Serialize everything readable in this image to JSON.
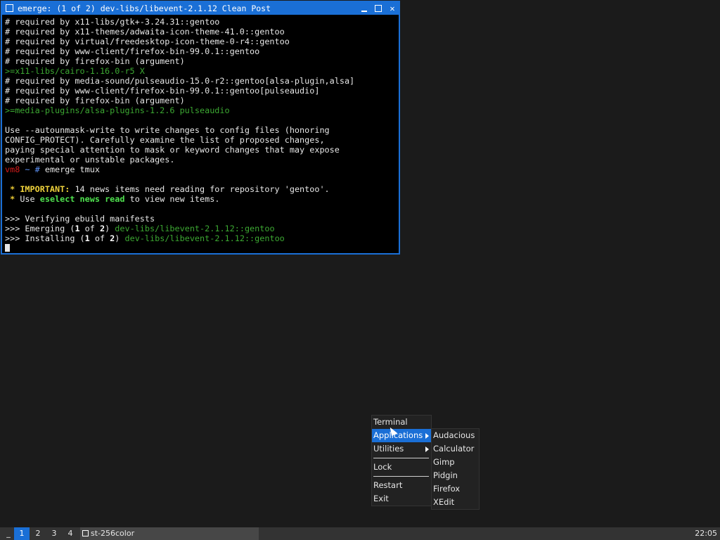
{
  "window": {
    "title": "emerge: (1 of 2) dev-libs/libevent-2.1.12 Clean Post"
  },
  "terminal_lines": [
    [
      {
        "t": "# required by x11-libs/gtk+-3.24.31::gentoo",
        "c": ""
      }
    ],
    [
      {
        "t": "# required by x11-themes/adwaita-icon-theme-41.0::gentoo",
        "c": ""
      }
    ],
    [
      {
        "t": "# required by virtual/freedesktop-icon-theme-0-r4::gentoo",
        "c": ""
      }
    ],
    [
      {
        "t": "# required by www-client/firefox-bin-99.0.1::gentoo",
        "c": ""
      }
    ],
    [
      {
        "t": "# required by firefox-bin (argument)",
        "c": ""
      }
    ],
    [
      {
        "t": ">=x11-libs/cairo-1.16.0-r5 X",
        "c": "green"
      }
    ],
    [
      {
        "t": "# required by media-sound/pulseaudio-15.0-r2::gentoo[alsa-plugin,alsa]",
        "c": ""
      }
    ],
    [
      {
        "t": "# required by www-client/firefox-bin-99.0.1::gentoo[pulseaudio]",
        "c": ""
      }
    ],
    [
      {
        "t": "# required by firefox-bin (argument)",
        "c": ""
      }
    ],
    [
      {
        "t": ">=media-plugins/alsa-plugins-1.2.6 pulseaudio",
        "c": "green"
      }
    ],
    [
      {
        "t": "",
        "c": ""
      }
    ],
    [
      {
        "t": "Use --autounmask-write to write changes to config files (honoring",
        "c": ""
      }
    ],
    [
      {
        "t": "CONFIG_PROTECT). Carefully examine the list of proposed changes,",
        "c": ""
      }
    ],
    [
      {
        "t": "paying special attention to mask or keyword changes that may expose",
        "c": ""
      }
    ],
    [
      {
        "t": "experimental or unstable packages.",
        "c": ""
      }
    ],
    [
      {
        "t": "vm8",
        "c": "red"
      },
      {
        "t": " ~ ",
        "c": "blue"
      },
      {
        "t": "# ",
        "c": "blue"
      },
      {
        "t": "emerge tmux",
        "c": ""
      }
    ],
    [
      {
        "t": "",
        "c": ""
      }
    ],
    [
      {
        "t": " * ",
        "c": "star"
      },
      {
        "t": "IMPORTANT:",
        "c": "yellowb"
      },
      {
        "t": " 14 news items need reading for repository 'gentoo'.",
        "c": ""
      }
    ],
    [
      {
        "t": " * ",
        "c": "star"
      },
      {
        "t": "Use ",
        "c": ""
      },
      {
        "t": "eselect news read",
        "c": "greenb"
      },
      {
        "t": " to view new items.",
        "c": ""
      }
    ],
    [
      {
        "t": "",
        "c": ""
      }
    ],
    [
      {
        "t": ">>> Verifying ebuild manifests",
        "c": ""
      }
    ],
    [
      {
        "t": ">>> Emerging (",
        "c": ""
      },
      {
        "t": "1",
        "c": "whiteb"
      },
      {
        "t": " of ",
        "c": ""
      },
      {
        "t": "2",
        "c": "whiteb"
      },
      {
        "t": ") ",
        "c": ""
      },
      {
        "t": "dev-libs/libevent-2.1.12::gentoo",
        "c": "green"
      }
    ],
    [
      {
        "t": ">>> Installing (",
        "c": ""
      },
      {
        "t": "1",
        "c": "whiteb"
      },
      {
        "t": " of ",
        "c": ""
      },
      {
        "t": "2",
        "c": "whiteb"
      },
      {
        "t": ") ",
        "c": ""
      },
      {
        "t": "dev-libs/libevent-2.1.12::gentoo",
        "c": "green"
      }
    ]
  ],
  "menu": {
    "items": [
      {
        "label": "Terminal"
      },
      {
        "label": "Applications"
      },
      {
        "label": "Utilities"
      },
      {
        "label": "Lock"
      },
      {
        "label": "Restart"
      },
      {
        "label": "Exit"
      }
    ]
  },
  "submenu": {
    "items": [
      {
        "label": "Audacious"
      },
      {
        "label": "Calculator"
      },
      {
        "label": "Gimp"
      },
      {
        "label": "Pidgin"
      },
      {
        "label": "Firefox"
      },
      {
        "label": "XEdit"
      }
    ]
  },
  "taskbar": {
    "dash": "_",
    "workspaces": [
      "1",
      "2",
      "3",
      "4"
    ],
    "active_workspace": "1",
    "task_label": "st-256color",
    "clock": "22:05"
  },
  "colors": {
    "accent": "#1a6fd6",
    "background": "#1b1b1b",
    "taskbar": "#333333"
  }
}
